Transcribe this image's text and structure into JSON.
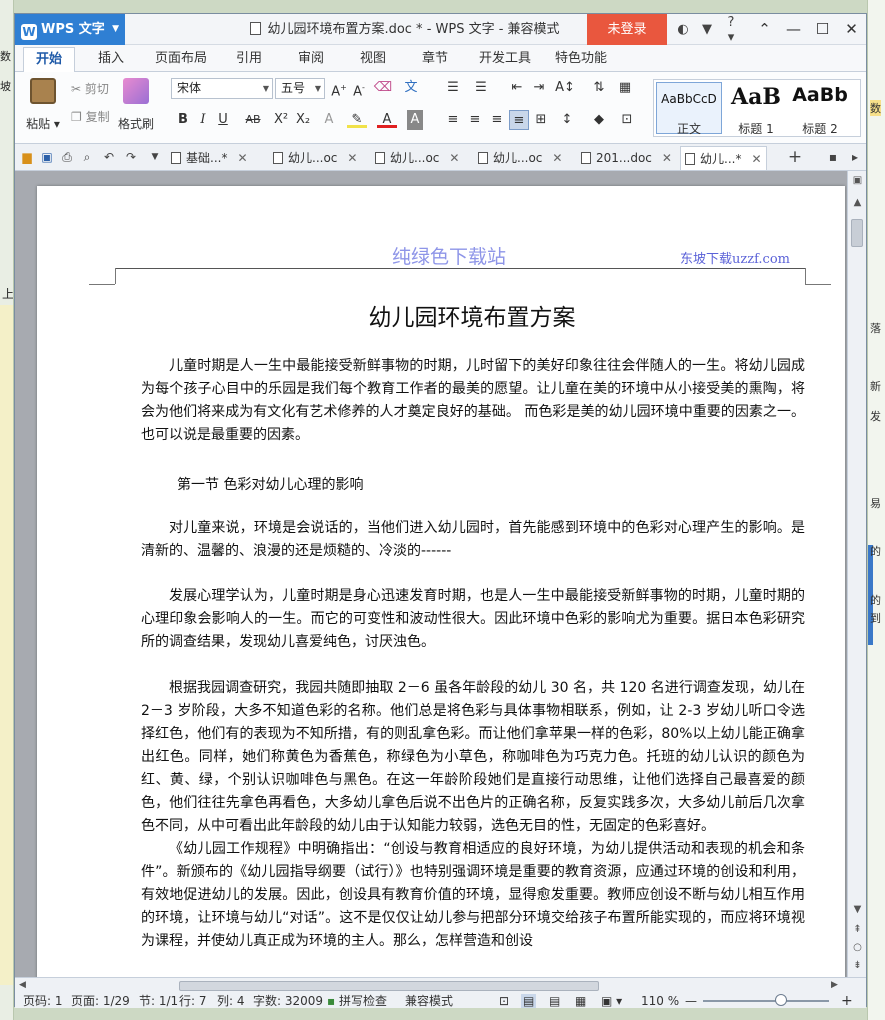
{
  "app": {
    "name": "WPS 文字",
    "doc_title": "幼儿园环境布置方案.doc * - WPS 文字 - 兼容模式",
    "login": "未登录",
    "help": "?"
  },
  "ribbon_tabs": [
    "开始",
    "插入",
    "页面布局",
    "引用",
    "审阅",
    "视图",
    "章节",
    "开发工具",
    "特色功能"
  ],
  "ribbon": {
    "paste": "粘贴",
    "cut": "剪切",
    "copy": "复制",
    "format_painter": "格式刷",
    "font_name": "宋体",
    "font_size": "五号",
    "bold": "B",
    "italic": "I",
    "underline": "U",
    "strike": "AB",
    "styles": [
      {
        "preview": "AaBbCcD",
        "name": "正文"
      },
      {
        "preview": "AaB",
        "name": "标题 1"
      },
      {
        "preview": "AaBb",
        "name": "标题 2"
      }
    ]
  },
  "doc_tabs": [
    {
      "label": "基础...*",
      "active": false
    },
    {
      "label": "幼儿...oc",
      "active": false
    },
    {
      "label": "幼儿...oc",
      "active": false
    },
    {
      "label": "幼儿...oc",
      "active": false
    },
    {
      "label": "201...doc",
      "active": false
    },
    {
      "label": "幼儿...*",
      "active": true
    }
  ],
  "document": {
    "header_watermark": "纯绿色下载站",
    "header_right": "东坡下载uzzf.com",
    "title": "幼儿园环境布置方案",
    "p1": "儿童时期是人一生中最能接受新鲜事物的时期，儿时留下的美好印象往往会伴随人的一生。将幼儿园成为每个孩子心目中的乐园是我们每个教育工作者的最美的愿望。让儿童在美的环境中从小接受美的熏陶，将会为他们将来成为有文化有艺术修养的人才奠定良好的基础。 而色彩是美的幼儿园环境中重要的因素之一。也可以说是最重要的因素。",
    "section1": "第一节  色彩对幼儿心理的影响",
    "p2": "对儿童来说，环境是会说话的，当他们进入幼儿园时，首先能感到环境中的色彩对心理产生的影响。是清新的、温馨的、浪漫的还是烦糙的、冷淡的------",
    "p3": "发展心理学认为，儿童时期是身心迅速发育时期，也是人一生中最能接受新鲜事物的时期，儿童时期的心理印象会影响人的一生。而它的可变性和波动性很大。因此环境中色彩的影响尤为重要。据日本色彩研究所的调查结果，发现幼儿喜爱纯色，讨厌浊色。",
    "p4": "根据我园调查研究，我园共随即抽取 2－6 虽各年龄段的幼儿 30 名，共 120 名进行调查发现，幼儿在 2－3 岁阶段，大多不知道色彩的名称。他们总是将色彩与具体事物相联系，例如，让 2-3 岁幼儿听口令选择红色，他们有的表现为不知所措，有的则乱拿色彩。而让他们拿苹果一样的色彩，80%以上幼儿能正确拿出红色。同样，她们称黄色为香蕉色，称绿色为小草色，称咖啡色为巧克力色。托班的幼儿认识的颜色为红、黄、绿，个别认识咖啡色与黑色。在这一年龄阶段她们是直接行动思维，让他们选择自己最喜爱的颜色，他们往往先拿色再看色，大多幼儿拿色后说不出色片的正确名称，反复实践多次，大多幼儿前后几次拿色不同，从中可看出此年龄段的幼儿由于认知能力较弱，选色无目的性，无固定的色彩喜好。",
    "p5": "《幼儿园工作规程》中明确指出：“创设与教育相适应的良好环境，为幼儿提供活动和表现的机会和条件”。新颁布的《幼儿园指导纲要（试行）》也特别强调环境是重要的教育资源，应通过环境的创设和利用，有效地促进幼儿的发展。因此，创设具有教育价值的环境，显得愈发重要。教师应创设不断与幼儿相互作用的环境，让环境与幼儿“对话”。这不是仅仅让幼儿参与把部分环境交给孩子布置所能实现的，而应将环境视为课程，并使幼儿真正成为环境的主人。那么，怎样营造和创设"
  },
  "status": {
    "page": "页码: 1",
    "pages": "页面: 1/29",
    "section": "节: 1/1",
    "row": "行: 7",
    "col": "列: 4",
    "words": "字数: 32009",
    "spell": "拼写检查",
    "compat": "兼容模式",
    "zoom": "110 %",
    "zoom_level": 0.62
  },
  "bg_right_labels": [
    "数",
    "落",
    "新",
    "发",
    "易",
    "的",
    "的",
    "到"
  ],
  "bg_left_labels": [
    "数",
    "坡",
    "上"
  ]
}
